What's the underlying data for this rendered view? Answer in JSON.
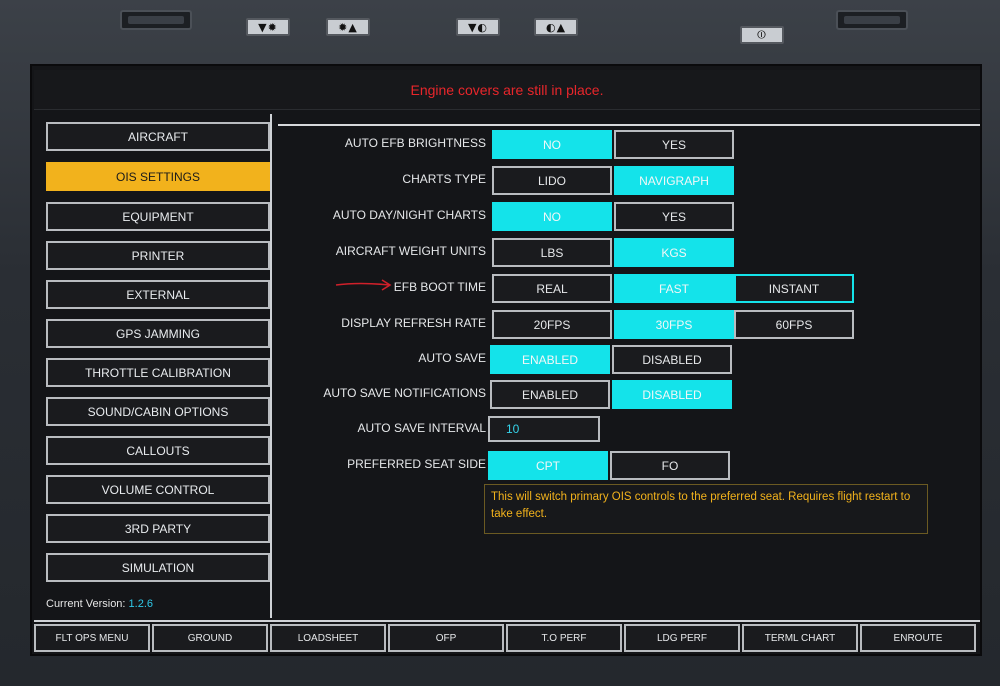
{
  "bezel": {
    "buttons": [
      {
        "name": "brightness-down-button",
        "label": "▼✹"
      },
      {
        "name": "brightness-up-button",
        "label": "✹▲"
      },
      {
        "name": "contrast-down-button",
        "label": "▼◐"
      },
      {
        "name": "contrast-up-button",
        "label": "◐▲"
      },
      {
        "name": "power-button",
        "label": "⏼"
      }
    ]
  },
  "alert": {
    "text": "Engine covers are still in place."
  },
  "sidebar": {
    "items": [
      {
        "label": "AIRCRAFT",
        "active": false
      },
      {
        "label": "OIS SETTINGS",
        "active": true
      },
      {
        "label": "EQUIPMENT",
        "active": false
      },
      {
        "label": "PRINTER",
        "active": false
      },
      {
        "label": "EXTERNAL",
        "active": false
      },
      {
        "label": "GPS JAMMING",
        "active": false
      },
      {
        "label": "THROTTLE CALIBRATION",
        "active": false
      },
      {
        "label": "SOUND/CABIN OPTIONS",
        "active": false
      },
      {
        "label": "CALLOUTS",
        "active": false
      },
      {
        "label": "VOLUME CONTROL",
        "active": false
      },
      {
        "label": "3RD PARTY",
        "active": false
      },
      {
        "label": "SIMULATION",
        "active": false
      }
    ],
    "version_label": "Current Version:",
    "version_value": "1.2.6"
  },
  "settings": [
    {
      "label": "AUTO EFB BRIGHTNESS",
      "options": [
        "NO",
        "YES"
      ],
      "selected": 0
    },
    {
      "label": "CHARTS TYPE",
      "options": [
        "LIDO",
        "NAVIGRAPH"
      ],
      "selected": 1
    },
    {
      "label": "AUTO DAY/NIGHT CHARTS",
      "options": [
        "NO",
        "YES"
      ],
      "selected": 0
    },
    {
      "label": "AIRCRAFT WEIGHT UNITS",
      "options": [
        "LBS",
        "KGS"
      ],
      "selected": 1
    },
    {
      "label": "EFB BOOT TIME",
      "options": [
        "REAL",
        "FAST",
        "INSTANT"
      ],
      "selected": 1,
      "hover": 2
    },
    {
      "label": "DISPLAY REFRESH RATE",
      "options": [
        "20FPS",
        "30FPS",
        "60FPS"
      ],
      "selected": 1
    },
    {
      "label": "AUTO SAVE",
      "options": [
        "ENABLED",
        "DISABLED"
      ],
      "selected": 0
    },
    {
      "label": "AUTO SAVE NOTIFICATIONS",
      "options": [
        "ENABLED",
        "DISABLED"
      ],
      "selected": 1
    },
    {
      "label": "AUTO SAVE INTERVAL",
      "input_value": "10"
    },
    {
      "label": "PREFERRED SEAT SIDE",
      "options": [
        "CPT",
        "FO"
      ],
      "selected": 0
    }
  ],
  "note": {
    "text": "This will switch primary OIS controls to the preferred seat. Requires flight restart to take effect."
  },
  "bottom_tabs": [
    "FLT OPS MENU",
    "GROUND",
    "LOADSHEET",
    "OFP",
    "T.O PERF",
    "LDG PERF",
    "TERML CHART",
    "ENROUTE"
  ],
  "colors": {
    "accent": "#14e3ea",
    "active_menu": "#f2b21c",
    "alert": "#e8262b",
    "annotation_arrow": "#d0202a"
  }
}
